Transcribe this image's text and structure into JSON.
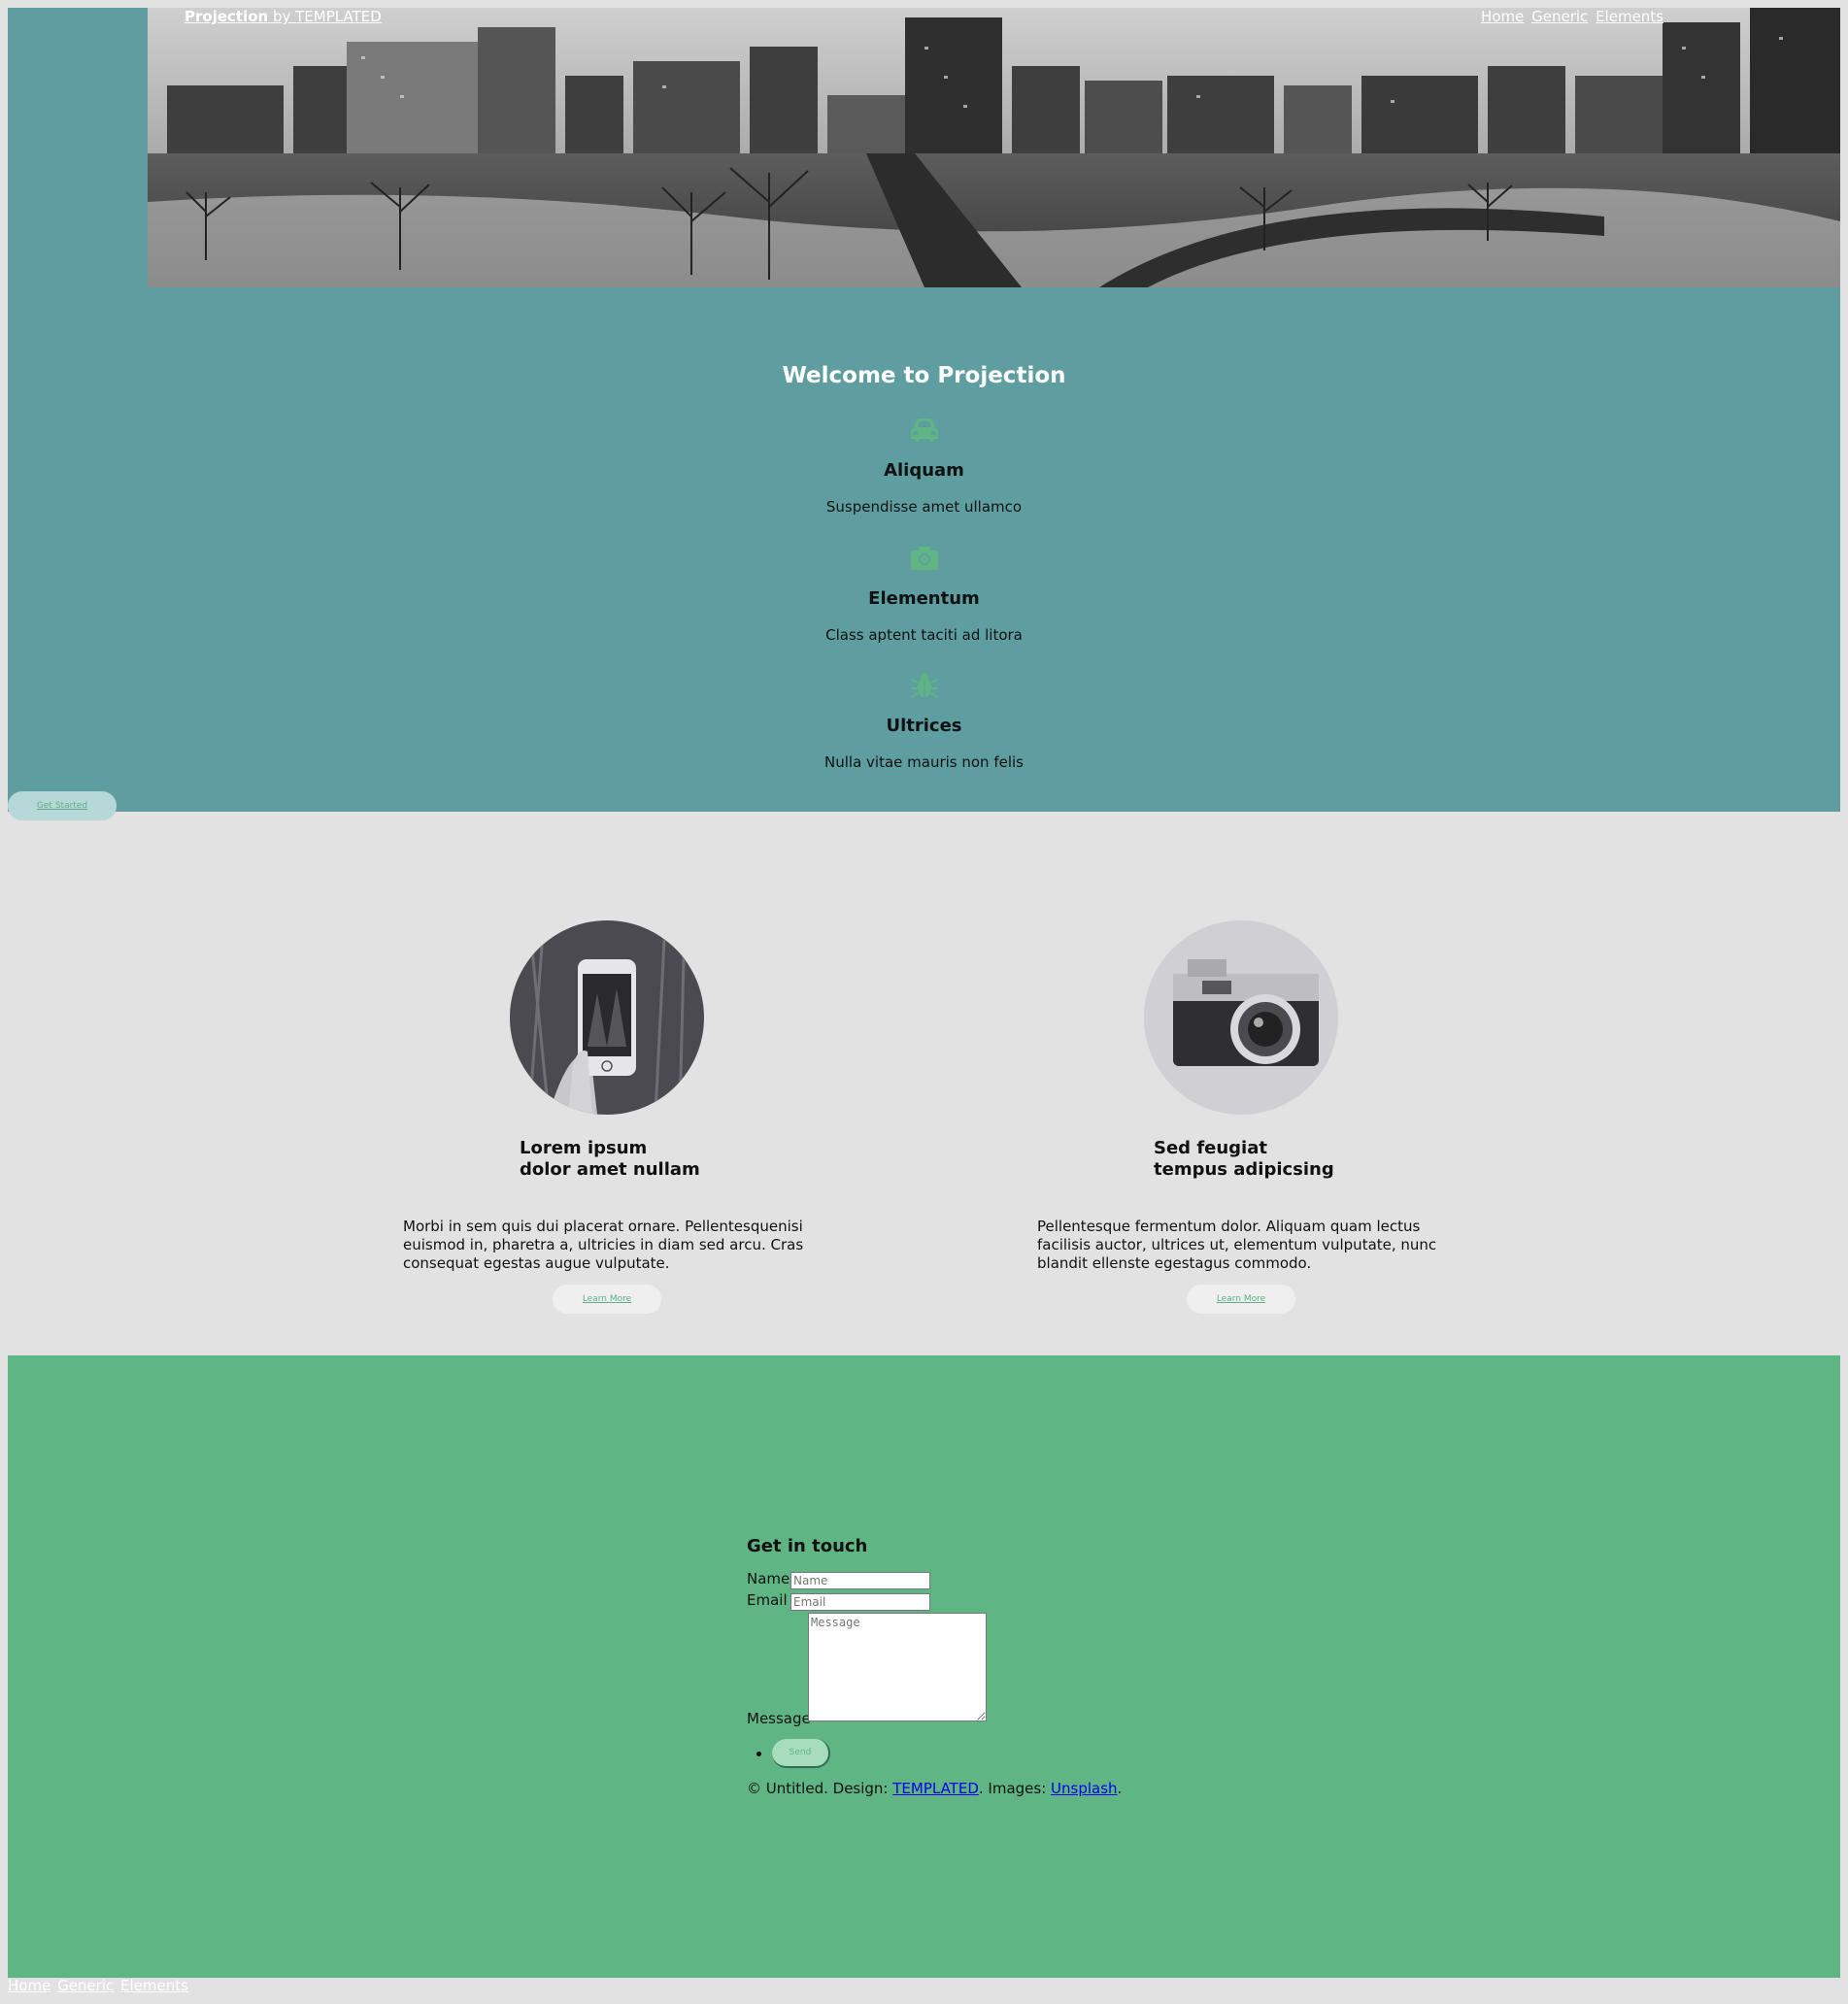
{
  "header": {
    "logo_brand": "Projection",
    "logo_suffix": " by TEMPLATED",
    "nav": [
      "Home",
      "Generic",
      "Elements"
    ]
  },
  "banner": {
    "title": "Welcome to Projection",
    "features": [
      {
        "icon": "car-icon",
        "title": "Aliquam",
        "text": "Suspendisse amet ullamco"
      },
      {
        "icon": "camera-icon",
        "title": "Elementum",
        "text": "Class aptent taciti ad litora"
      },
      {
        "icon": "bug-icon",
        "title": "Ultrices",
        "text": "Nulla vitae mauris non felis"
      }
    ],
    "cta": "Get Started"
  },
  "spotlights": [
    {
      "image": "phone-photo",
      "title_line1": "Lorem ipsum",
      "title_line2": "dolor amet nullam",
      "text": "Morbi in sem quis dui placerat ornare. Pellentesquenisi euismod in, pharetra a, ultricies in diam sed arcu. Cras consequat egestas augue vulputate.",
      "button": "Learn More"
    },
    {
      "image": "camera-photo",
      "title_line1": "Sed feugiat",
      "title_line2": "tempus adipicsing",
      "text": "Pellentesque fermentum dolor. Aliquam quam lectus facilisis auctor, ultrices ut, elementum vulputate, nunc blandit ellenste egestagus commodo.",
      "button": "Learn More"
    }
  ],
  "contact": {
    "title": "Get in touch",
    "name_label": "Name",
    "name_placeholder": "Name",
    "email_label": "Email",
    "email_placeholder": "Email",
    "message_label": "Message",
    "message_placeholder": "Message",
    "send": "Send",
    "copyright_prefix": "© Untitled. Design: ",
    "design_link": "TEMPLATED",
    "images_prefix": ". Images: ",
    "images_link": "Unsplash",
    "copyright_suffix": "."
  },
  "footer_nav": [
    "Home",
    "Generic",
    "Elements"
  ],
  "colors": {
    "hero_bg": "#5f9ea0",
    "accent_green": "#5fb584",
    "page_bg": "#e2e2e2"
  }
}
